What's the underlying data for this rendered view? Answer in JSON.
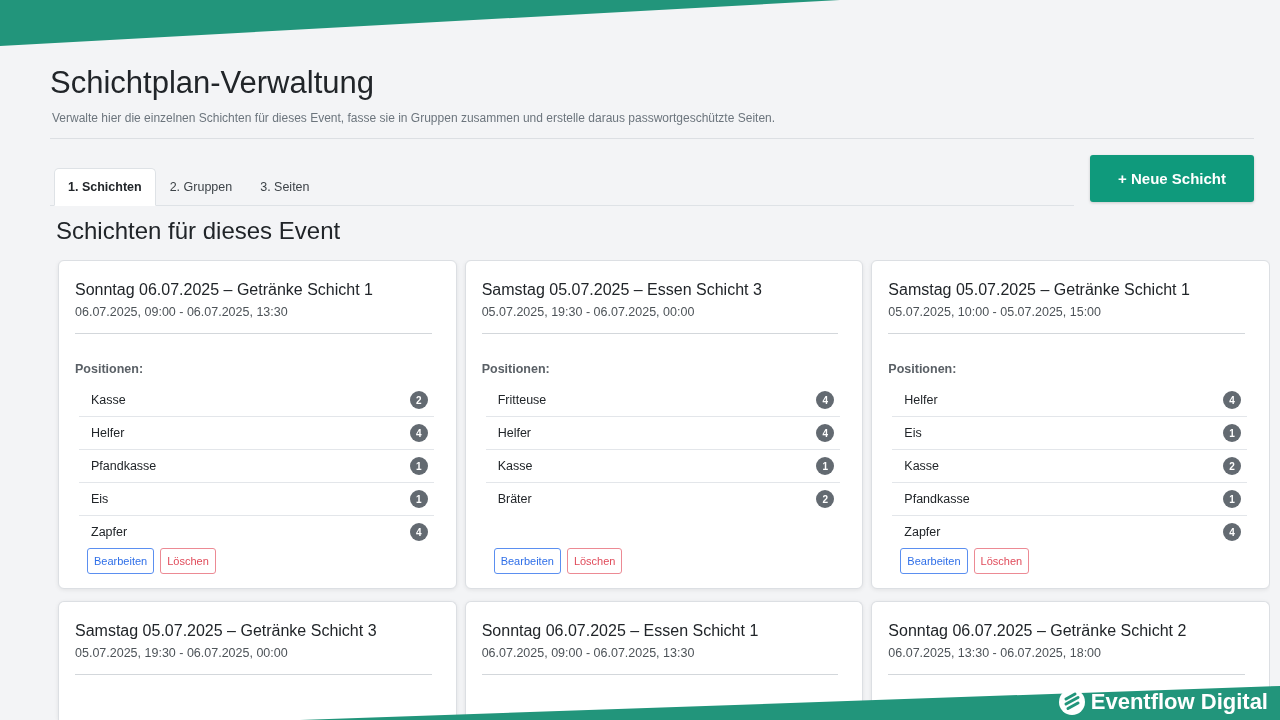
{
  "page": {
    "title": "Schichtplan-Verwaltung",
    "subtitle": "Verwalte hier die einzelnen Schichten für dieses Event, fasse sie in Gruppen zusammen und erstelle daraus passwortgeschützte Seiten."
  },
  "tabs": [
    {
      "label": "1. Schichten",
      "selected": true
    },
    {
      "label": "2. Gruppen",
      "selected": false
    },
    {
      "label": "3. Seiten",
      "selected": false
    }
  ],
  "new_button": {
    "label": "+ Neue Schicht"
  },
  "section_title": "Schichten für dieses Event",
  "shifts": [
    {
      "title": "Sonntag 06.07.2025 – Getränke Schicht 1",
      "time": "06.07.2025, 09:00 - 06.07.2025, 13:30",
      "positions_label": "Positionen:",
      "positions": [
        {
          "name": "Kasse",
          "count": "2"
        },
        {
          "name": "Helfer",
          "count": "4"
        },
        {
          "name": "Pfandkasse",
          "count": "1"
        },
        {
          "name": "Eis",
          "count": "1"
        },
        {
          "name": "Zapfer",
          "count": "4"
        }
      ],
      "buttons": [
        {
          "kind": "edit",
          "label": "Bearbeiten"
        },
        {
          "kind": "delete",
          "label": "Löschen"
        }
      ]
    },
    {
      "title": "Samstag 05.07.2025 – Essen Schicht 3",
      "time": "05.07.2025, 19:30 - 06.07.2025, 00:00",
      "positions_label": "Positionen:",
      "positions": [
        {
          "name": "Fritteuse",
          "count": "4"
        },
        {
          "name": "Helfer",
          "count": "4"
        },
        {
          "name": "Kasse",
          "count": "1"
        },
        {
          "name": "Bräter",
          "count": "2"
        }
      ],
      "buttons": [
        {
          "kind": "edit",
          "label": "Bearbeiten"
        },
        {
          "kind": "delete",
          "label": "Löschen"
        }
      ]
    },
    {
      "title": "Samstag 05.07.2025 – Getränke Schicht 1",
      "time": "05.07.2025, 10:00 - 05.07.2025, 15:00",
      "positions_label": "Positionen:",
      "positions": [
        {
          "name": "Helfer",
          "count": "4"
        },
        {
          "name": "Eis",
          "count": "1"
        },
        {
          "name": "Kasse",
          "count": "2"
        },
        {
          "name": "Pfandkasse",
          "count": "1"
        },
        {
          "name": "Zapfer",
          "count": "4"
        }
      ],
      "buttons": [
        {
          "kind": "edit",
          "label": "Bearbeiten"
        },
        {
          "kind": "delete",
          "label": "Löschen"
        }
      ]
    },
    {
      "title": "Samstag 05.07.2025 – Getränke Schicht 3",
      "time": "05.07.2025, 19:30 - 06.07.2025, 00:00"
    },
    {
      "title": "Sonntag 06.07.2025 – Essen Schicht 1",
      "time": "06.07.2025, 09:00 - 06.07.2025, 13:30"
    },
    {
      "title": "Sonntag 06.07.2025 – Getränke Schicht 2",
      "time": "06.07.2025, 13:30 - 06.07.2025, 18:00"
    }
  ],
  "brand": {
    "name": "Eventflow Digital"
  }
}
